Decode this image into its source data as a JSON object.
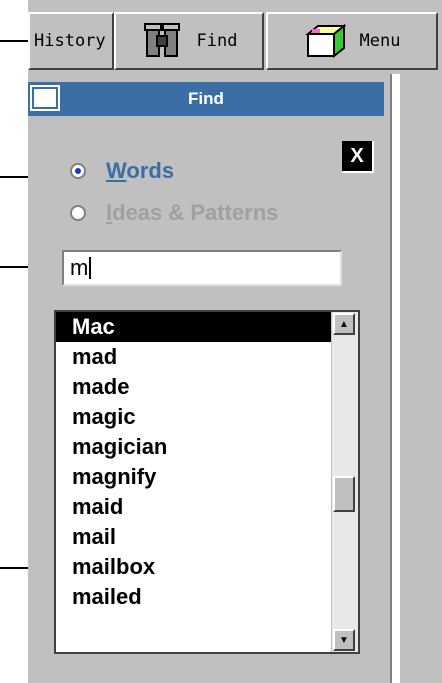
{
  "toolbar": {
    "history_label": "History",
    "find_label": "Find",
    "menu_label": "Menu"
  },
  "find_panel": {
    "title": "Find",
    "close_label": "X",
    "options": [
      {
        "label": "Words",
        "checked": true
      },
      {
        "label": "Ideas & Patterns",
        "checked": false
      }
    ],
    "search_value": "m",
    "results": [
      "Mac",
      "mad",
      "made",
      "magic",
      "magician",
      "magnify",
      "maid",
      "mail",
      "mailbox",
      "mailed"
    ],
    "selected_result": "Mac"
  },
  "colors": {
    "title_bar": "#3a6ea5",
    "panel_bg": "#c0c0c0",
    "selected_bg": "#000000"
  },
  "icons": [
    "binoculars-icon",
    "menu-folder-icon",
    "window-icon",
    "scroll-up-icon",
    "scroll-down-icon"
  ]
}
